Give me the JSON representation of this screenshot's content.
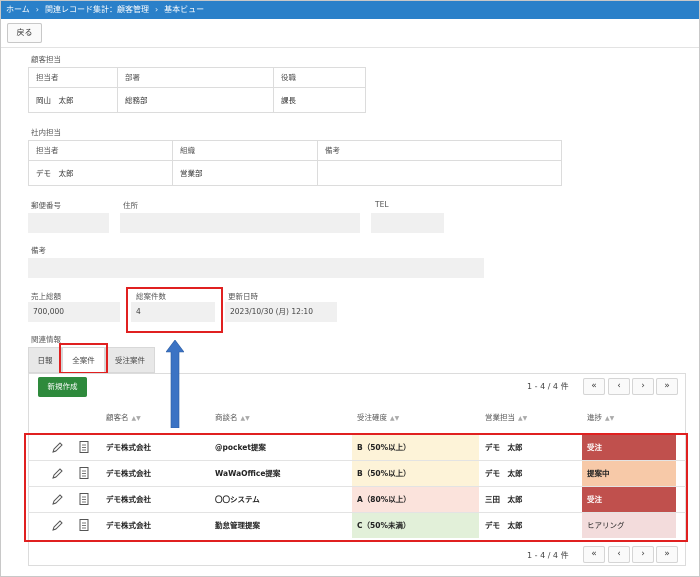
{
  "breadcrumb": [
    "ホーム",
    "関連レコード集計：顧客管理",
    "基本ビュー"
  ],
  "toolbar": {
    "back_label": "戻る"
  },
  "customer_contact": {
    "section_label": "顧客担当",
    "headers": [
      "担当者",
      "部署",
      "役職"
    ],
    "values": [
      "岡山　太郎",
      "総務部",
      "課長"
    ]
  },
  "internal_contact": {
    "section_label": "社内担当",
    "headers": [
      "担当者",
      "組織",
      "備考"
    ],
    "values": [
      "デモ　太郎",
      "営業部",
      ""
    ]
  },
  "address": {
    "postal_label": "郵便番号",
    "postal_value": "",
    "address_label": "住所",
    "address_value": "",
    "tel_label": "TEL",
    "tel_value": ""
  },
  "notes": {
    "label": "備考",
    "value": ""
  },
  "summary": {
    "sales_label": "売上総額",
    "sales_value": "700,000",
    "cases_label": "総案件数",
    "cases_value": "4",
    "updated_label": "更新日時",
    "updated_value": "2023/10/30 (月) 12:10"
  },
  "related": {
    "label": "関連情報",
    "tabs": [
      "日報",
      "全案件",
      "受注案件"
    ],
    "active_tab": "全案件",
    "new_button": "新規作成",
    "pager": "1 - 4 / 4 件",
    "columns": [
      "顧客名",
      "商談名",
      "受注確度",
      "営業担当",
      "進捗"
    ],
    "rows": [
      {
        "customer": "デモ株式会社",
        "deal": "@pocket提案",
        "probability": "B（50%以上）",
        "rep": "デモ　太郎",
        "progress": "受注",
        "prob_color": "#fdf3d8",
        "prog_color": "#c0504d",
        "prog_text_color": "#ffffff"
      },
      {
        "customer": "デモ株式会社",
        "deal": "WaWaOffice提案",
        "probability": "B（50%以上）",
        "rep": "デモ　太郎",
        "progress": "提案中",
        "prob_color": "#fdf3d8",
        "prog_color": "#f7c9a8",
        "prog_text_color": "#222222"
      },
      {
        "customer": "デモ株式会社",
        "deal": "〇〇システム",
        "probability": "A（80%以上）",
        "rep": "三田　太郎",
        "progress": "受注",
        "prob_color": "#fbe3dc",
        "prog_color": "#c0504d",
        "prog_text_color": "#ffffff"
      },
      {
        "customer": "デモ株式会社",
        "deal": "勤怠管理提案",
        "probability": "C（50%未満）",
        "rep": "デモ　太郎",
        "progress": "ヒアリング",
        "prob_color": "#e2f0d9",
        "prog_color": "#f3dcdc",
        "prog_text_color": "#222222"
      }
    ]
  },
  "icons": {
    "edit": "pencil-icon",
    "detail": "document-icon"
  },
  "colors": {
    "topbar": "#2a80c9",
    "highlight": "#e02020",
    "new_button": "#2e8a3c",
    "arrow": "#3b73c4"
  }
}
